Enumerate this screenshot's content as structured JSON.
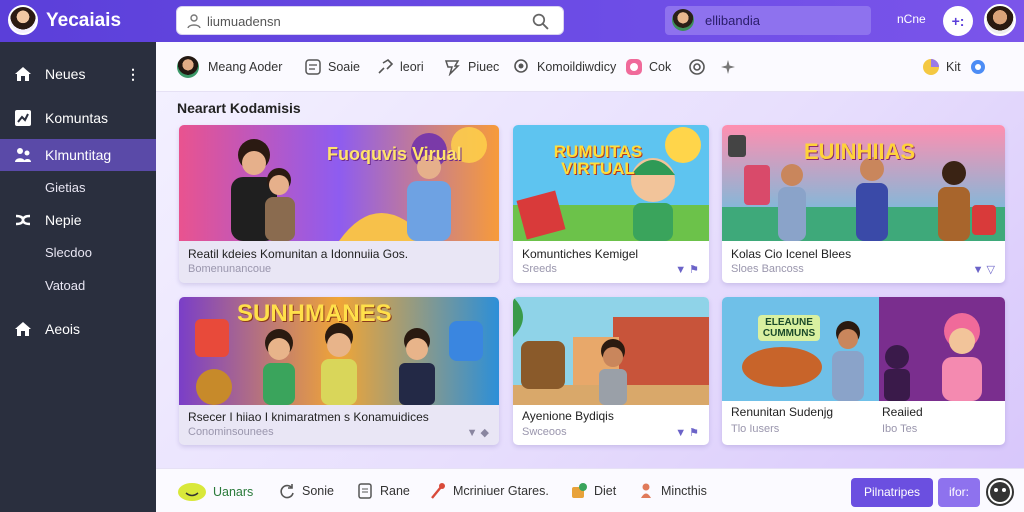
{
  "app": {
    "title": "Yecaiais"
  },
  "search": {
    "text": "liumuadensn"
  },
  "user": {
    "name": "ellibandia",
    "action_text": "nCne",
    "action_button": "+:"
  },
  "sidebar": {
    "items": [
      {
        "label": "Neues",
        "icon": "home-icon"
      },
      {
        "label": "Komuntas",
        "icon": "chart-icon"
      },
      {
        "label": "Klmuntitag",
        "icon": "community-icon",
        "active": true
      },
      {
        "label": "Gietias",
        "icon": "",
        "sub": true
      },
      {
        "label": "Nepie",
        "icon": "shuffle-icon"
      },
      {
        "label": "Slecdoo",
        "icon": "",
        "sub": true
      },
      {
        "label": "Vatoad",
        "icon": "",
        "sub": true
      },
      {
        "label": "Aeois",
        "icon": "home-icon"
      }
    ]
  },
  "toolbar": {
    "items": [
      {
        "label": "Meang Aoder",
        "icon": "avatar"
      },
      {
        "label": "Soaie",
        "icon": "chat-icon"
      },
      {
        "label": "leori",
        "icon": "link-icon"
      },
      {
        "label": "Piuec",
        "icon": "tag-icon"
      },
      {
        "label": "Komoildiwdicy",
        "icon": "search-icon"
      },
      {
        "label": "Cok",
        "icon": "palette-icon"
      },
      {
        "label": "",
        "icon": "ring-icon"
      },
      {
        "label": "",
        "icon": "sparkle-icon"
      }
    ],
    "right_label": "Kit"
  },
  "section": {
    "title": "Nearart Kodamisis"
  },
  "cards": [
    {
      "title": "Reatil kdeies Komunitan a Idonnuiia Gos.",
      "sub": "Bomenunancoue",
      "art_text": "Fuoquvis Virual",
      "dim": true
    },
    {
      "title": "Komuntiches Kemigel",
      "sub": "Sreeds",
      "art_text": "RUMUITAS VIRTUAL"
    },
    {
      "title": "Kolas Cio Icenel Blees",
      "sub": "Sloes Bancoss",
      "art_text": "EUINHIIAS"
    },
    {
      "title": "Rsecer I hiiao I knimaratmen s Konamuidices",
      "sub": "Conominsounees",
      "art_text": "SUNHMANES",
      "dim": true
    },
    {
      "title": "Ayenione Bydiqis",
      "sub": "Swceoos",
      "art_text": ""
    },
    {
      "title": "Renunitan Sudenjg",
      "sub": "Tlo Iusers",
      "art_text": "ELEAUNE CUMMUNS"
    },
    {
      "title": "Reaiied",
      "sub": "Ibo Tes",
      "art_text": ""
    }
  ],
  "bottombar": {
    "items": [
      {
        "label": "Uanars",
        "icon": "smile-icon"
      },
      {
        "label": "Sonie",
        "icon": "refresh-icon"
      },
      {
        "label": "Rane",
        "icon": "document-icon"
      },
      {
        "label": "Mcriniuer Gtares.",
        "icon": "music-icon"
      },
      {
        "label": "Diet",
        "icon": "pin-icon"
      },
      {
        "label": "Mincthis",
        "icon": "figure-icon"
      }
    ],
    "primary_button": "Pilnatripes",
    "secondary_button": "ifor:"
  },
  "colors": {
    "accent": "#6b4fe0",
    "sidebar": "#2a2f3e",
    "active": "#5a4aa8"
  }
}
